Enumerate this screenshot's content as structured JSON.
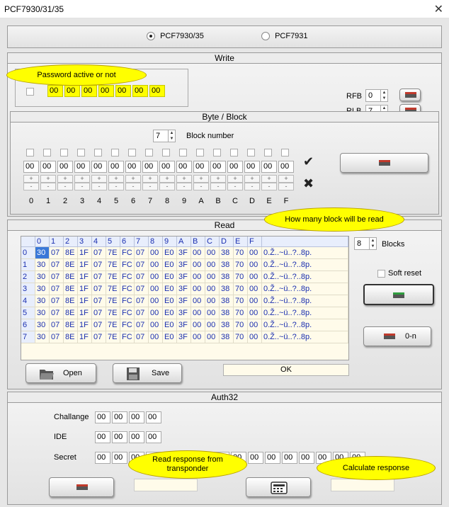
{
  "window": {
    "title": "PCF7930/31/35",
    "close_symbol": "✕"
  },
  "mode": {
    "options": [
      {
        "label": "PCF7930/35",
        "selected": true
      },
      {
        "label": "PCF7931",
        "selected": false
      }
    ]
  },
  "write": {
    "title": "Write",
    "password_callout": "Password active or not",
    "password_bytes": [
      "00",
      "00",
      "00",
      "00",
      "00",
      "00",
      "00"
    ],
    "rfb_label": "RFB",
    "rfb_value": "0",
    "rlb_label": "RLB",
    "rlb_value": "7",
    "byte_block": {
      "title": "Byte / Block",
      "block_number_value": "7",
      "block_number_label": "Block number",
      "bytes": [
        "00",
        "00",
        "00",
        "00",
        "00",
        "00",
        "00",
        "00",
        "00",
        "00",
        "00",
        "00",
        "00",
        "00",
        "00",
        "00"
      ],
      "plus": "+",
      "minus": "-",
      "bit_labels": [
        "0",
        "1",
        "2",
        "3",
        "4",
        "5",
        "6",
        "7",
        "8",
        "9",
        "A",
        "B",
        "C",
        "D",
        "E",
        "F"
      ],
      "ok_mark": "✔",
      "cancel_mark": "✖"
    }
  },
  "read": {
    "title": "Read",
    "blocks_callout": "How many block will be read",
    "blocks_value": "8",
    "blocks_label": "Blocks",
    "soft_reset_label": "Soft reset",
    "button_0n_label": "0-n",
    "columns": [
      "0",
      "1",
      "2",
      "3",
      "4",
      "5",
      "6",
      "7",
      "8",
      "9",
      "A",
      "B",
      "C",
      "D",
      "E",
      "F"
    ],
    "rows": [
      {
        "index": "0",
        "bytes": [
          "30",
          "07",
          "8E",
          "1F",
          "07",
          "7E",
          "FC",
          "07",
          "00",
          "E0",
          "3F",
          "00",
          "00",
          "38",
          "70",
          "00"
        ],
        "ascii": "0.Ž..~ü..?..8p."
      },
      {
        "index": "1",
        "bytes": [
          "30",
          "07",
          "8E",
          "1F",
          "07",
          "7E",
          "FC",
          "07",
          "00",
          "E0",
          "3F",
          "00",
          "00",
          "38",
          "70",
          "00"
        ],
        "ascii": "0.Ž..~ü..?..8p."
      },
      {
        "index": "2",
        "bytes": [
          "30",
          "07",
          "8E",
          "1F",
          "07",
          "7E",
          "FC",
          "07",
          "00",
          "E0",
          "3F",
          "00",
          "00",
          "38",
          "70",
          "00"
        ],
        "ascii": "0.Ž..~ü..?..8p."
      },
      {
        "index": "3",
        "bytes": [
          "30",
          "07",
          "8E",
          "1F",
          "07",
          "7E",
          "FC",
          "07",
          "00",
          "E0",
          "3F",
          "00",
          "00",
          "38",
          "70",
          "00"
        ],
        "ascii": "0.Ž..~ü..?..8p."
      },
      {
        "index": "4",
        "bytes": [
          "30",
          "07",
          "8E",
          "1F",
          "07",
          "7E",
          "FC",
          "07",
          "00",
          "E0",
          "3F",
          "00",
          "00",
          "38",
          "70",
          "00"
        ],
        "ascii": "0.Ž..~ü..?..8p."
      },
      {
        "index": "5",
        "bytes": [
          "30",
          "07",
          "8E",
          "1F",
          "07",
          "7E",
          "FC",
          "07",
          "00",
          "E0",
          "3F",
          "00",
          "00",
          "38",
          "70",
          "00"
        ],
        "ascii": "0.Ž..~ü..?..8p."
      },
      {
        "index": "6",
        "bytes": [
          "30",
          "07",
          "8E",
          "1F",
          "07",
          "7E",
          "FC",
          "07",
          "00",
          "E0",
          "3F",
          "00",
          "00",
          "38",
          "70",
          "00"
        ],
        "ascii": "0.Ž..~ü..?..8p."
      },
      {
        "index": "7",
        "bytes": [
          "30",
          "07",
          "8E",
          "1F",
          "07",
          "7E",
          "FC",
          "07",
          "00",
          "E0",
          "3F",
          "00",
          "00",
          "38",
          "70",
          "00"
        ],
        "ascii": "0.Ž..~ü..?..8p."
      }
    ],
    "open_label": "Open",
    "save_label": "Save",
    "status": "OK"
  },
  "auth": {
    "title": "Auth32",
    "challange_label": "Challange",
    "challange": [
      "00",
      "00",
      "00",
      "00"
    ],
    "ide_label": "IDE",
    "ide": [
      "00",
      "00",
      "00",
      "00"
    ],
    "secret_label": "Secret",
    "secret": [
      "00",
      "00",
      "00",
      "00",
      "00",
      "00",
      "00",
      "00",
      "00",
      "00",
      "00",
      "00",
      "00",
      "00",
      "00",
      "00"
    ],
    "read_callout": "Read response from transponder",
    "calc_callout": "Calculate response"
  },
  "colors": {
    "highlight": "#ffff00",
    "grid_text": "#1a2fb0",
    "grid_bg": "#fffbea"
  }
}
